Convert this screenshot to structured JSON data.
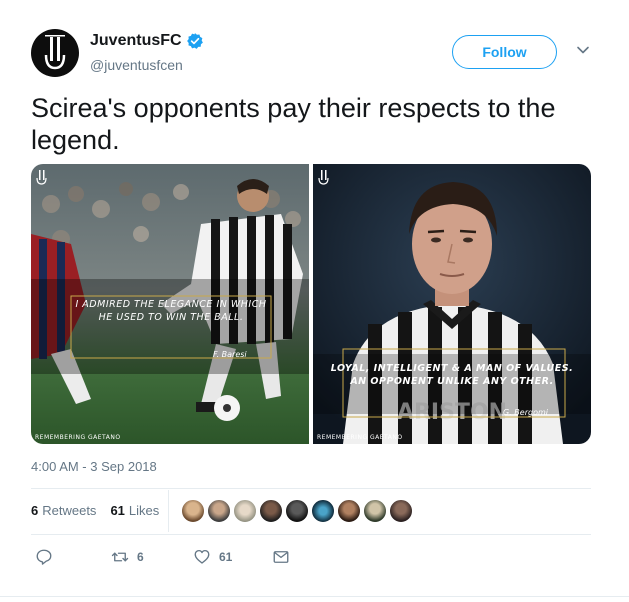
{
  "user": {
    "display_name": "JuventusFC",
    "handle": "@juventusfcen",
    "verified_icon": "verified-badge-icon",
    "avatar_icon": "juventus-logo-icon"
  },
  "follow_label": "Follow",
  "tweet_text": "Scirea's opponents pay their respects to the legend.",
  "media": {
    "left": {
      "quote": "I admired the elegance in which he used to win the ball.",
      "signature": "F. Baresi",
      "footer": "REMEMBERING GAETANO"
    },
    "right": {
      "quote": "Loyal, intelligent & a man of values. An opponent unlike any other.",
      "signature": "G. Bergomi",
      "footer": "REMEMBERING GAETANO",
      "shirt_text": "ARISTON"
    }
  },
  "timestamp": "4:00 AM - 3 Sep 2018",
  "stats": {
    "retweets_count": "6",
    "retweets_label": "Retweets",
    "likes_count": "61",
    "likes_label": "Likes"
  },
  "actions": {
    "reply_icon": "reply-icon",
    "retweet_count": "6",
    "like_count": "61",
    "message_icon": "direct-message-icon"
  },
  "colors": {
    "brand_blue": "#1da1f2",
    "text_primary": "#14171a",
    "text_secondary": "#657786",
    "divider": "#e6ecf0"
  }
}
